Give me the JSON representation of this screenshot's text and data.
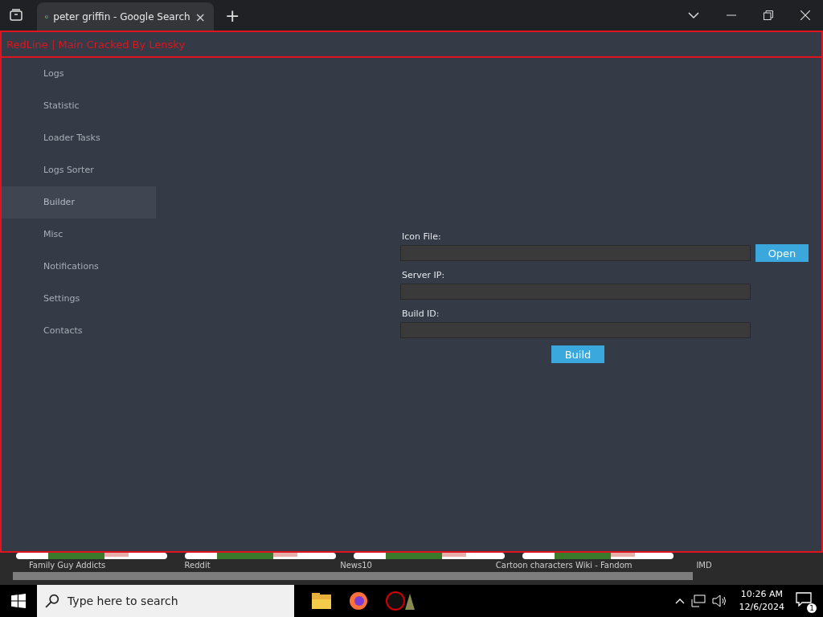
{
  "browser": {
    "tab": {
      "title": "peter griffin - Google Search",
      "close": "×"
    },
    "new_tab": "+"
  },
  "app": {
    "title": "RedLine | Main Cracked By Lensky",
    "sidebar": {
      "items": [
        {
          "label": "Logs",
          "selected": false
        },
        {
          "label": "Statistic",
          "selected": false
        },
        {
          "label": "Loader Tasks",
          "selected": false
        },
        {
          "label": "Logs Sorter",
          "selected": false
        },
        {
          "label": "Builder",
          "selected": true
        },
        {
          "label": "Misc",
          "selected": false
        },
        {
          "label": "Notifications",
          "selected": false
        },
        {
          "label": "Settings",
          "selected": false
        },
        {
          "label": "Contacts",
          "selected": false
        }
      ]
    },
    "form": {
      "fields": [
        {
          "label": "Icon File:",
          "button": "Open"
        },
        {
          "label": "Server IP:"
        },
        {
          "label": "Build ID:"
        }
      ],
      "build_button": "Build"
    }
  },
  "bookmarks": [
    "Family Guy Addicts",
    "Reddit",
    "News10",
    "Cartoon characters Wiki - Fandom",
    "IMD"
  ],
  "taskbar": {
    "search": {
      "placeholder": "Type here to search"
    },
    "time": "10:26 AM",
    "date": "12/6/2024",
    "notifications": "1"
  }
}
